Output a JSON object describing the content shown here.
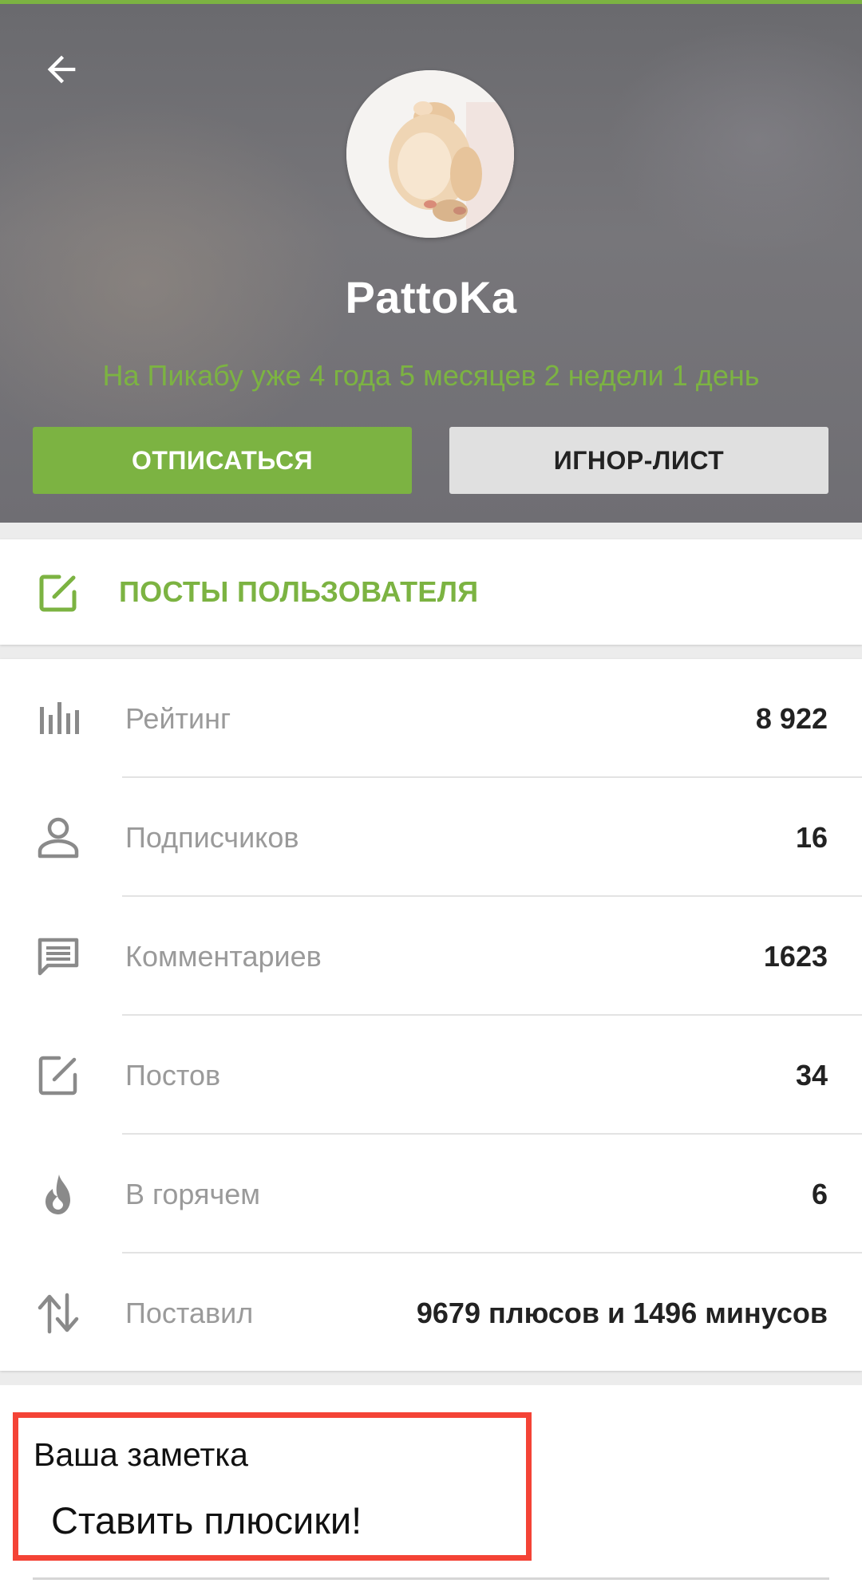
{
  "header": {
    "back_icon": "arrow-left-icon",
    "username": "PattoKa",
    "member_since": "На Пикабу уже 4 года 5 месяцев 2 недели 1 день",
    "unsubscribe_label": "ОТПИСАТЬСЯ",
    "ignore_label": "ИГНОР-ЛИСТ",
    "accent_color": "#7cb342"
  },
  "posts_link": {
    "icon": "edit-icon",
    "label": "ПОСТЫ ПОЛЬЗОВАТЕЛЯ"
  },
  "stats": [
    {
      "icon": "bar-chart-icon",
      "label": "Рейтинг",
      "value": "8 922"
    },
    {
      "icon": "person-icon",
      "label": "Подписчиков",
      "value": "16"
    },
    {
      "icon": "comment-icon",
      "label": "Комментариев",
      "value": "1623"
    },
    {
      "icon": "edit-icon",
      "label": "Постов",
      "value": "34"
    },
    {
      "icon": "flame-icon",
      "label": "В горячем",
      "value": "6"
    },
    {
      "icon": "swap-vertical-icon",
      "label": "Поставил",
      "value": "9679 плюсов и 1496 минусов"
    }
  ],
  "note": {
    "title": "Ваша заметка",
    "text": "Ставить плюсики!",
    "highlight_color": "#f44336"
  }
}
